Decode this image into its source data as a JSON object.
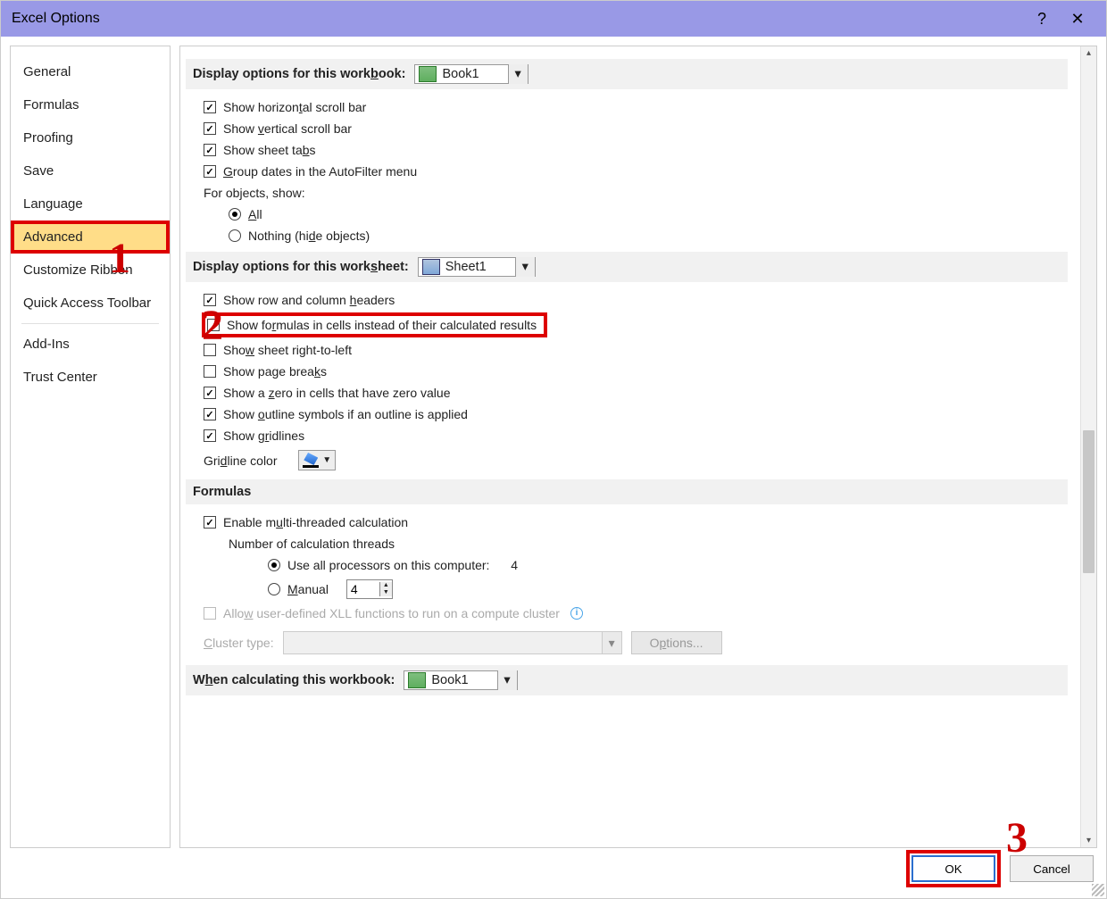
{
  "title": "Excel Options",
  "titlebar": {
    "help": "?",
    "close": "✕"
  },
  "annotations": {
    "a1": "1",
    "a2": "2",
    "a3": "3"
  },
  "sidebar": {
    "items": [
      {
        "label": "General"
      },
      {
        "label": "Formulas"
      },
      {
        "label": "Proofing"
      },
      {
        "label": "Save"
      },
      {
        "label": "Language"
      },
      {
        "label": "Advanced",
        "selected": true
      },
      {
        "label": "Customize Ribbon"
      },
      {
        "label": "Quick Access Toolbar"
      },
      {
        "label": "Add-Ins"
      },
      {
        "label": "Trust Center"
      }
    ]
  },
  "sec_workbook": {
    "title_pre": "Display options for this work",
    "title_u": "b",
    "title_post": "ook:",
    "dd": "Book1"
  },
  "wb_opts": {
    "hscroll_pre": "Show horizon",
    "hscroll_u": "t",
    "hscroll_post": "al scroll bar",
    "vscroll_pre": "Show ",
    "vscroll_u": "v",
    "vscroll_post": "ertical scroll bar",
    "tabs_pre": "Show sheet ta",
    "tabs_u": "b",
    "tabs_post": "s",
    "group_pre": "",
    "group_u": "G",
    "group_post": "roup dates in the AutoFilter menu",
    "objlabel": "For objects, show:",
    "all_u": "A",
    "all_post": "ll",
    "nothing_pre": "Nothing (hi",
    "nothing_u": "d",
    "nothing_post": "e objects)"
  },
  "sec_worksheet": {
    "title_pre": "Display options for this work",
    "title_u": "s",
    "title_post": "heet:",
    "dd": "Sheet1"
  },
  "ws_opts": {
    "headers_pre": "Show row and column ",
    "headers_u": "h",
    "headers_post": "eaders",
    "formulas_pre": "Show fo",
    "formulas_u": "r",
    "formulas_post": "mulas in cells instead of their calculated results",
    "rtl_pre": "Sho",
    "rtl_u": "w",
    "rtl_post": " sheet right-to-left",
    "pgbrk_pre": "Show page brea",
    "pgbrk_u": "k",
    "pgbrk_post": "s",
    "zero_pre": "Show a ",
    "zero_u": "z",
    "zero_post": "ero in cells that have zero value",
    "outline_pre": "Show ",
    "outline_u": "o",
    "outline_post": "utline symbols if an outline is applied",
    "grid_pre": "Show g",
    "grid_u": "r",
    "grid_post": "idlines",
    "gridcolor_pre": "Gri",
    "gridcolor_u": "d",
    "gridcolor_post": "line color"
  },
  "sec_formulas": {
    "title": "Formulas"
  },
  "f_opts": {
    "multi_pre": "Enable m",
    "multi_u": "u",
    "multi_post": "lti-threaded calculation",
    "threads_label": "Number of calculation threads",
    "all_proc": "Use all processors on this computer:",
    "proc_count": "4",
    "manual_u": "M",
    "manual_post": "anual",
    "manual_val": "4",
    "xll_pre": "Allo",
    "xll_u": "w",
    "xll_post": " user-defined XLL functions to run on a compute cluster",
    "cluster_pre": "",
    "cluster_u": "C",
    "cluster_post": "luster type:",
    "options_btn_pre": "O",
    "options_btn_u": "p",
    "options_btn_post": "tions..."
  },
  "sec_calc": {
    "title_pre": "W",
    "title_u": "h",
    "title_post": "en calculating this workbook:",
    "dd": "Book1"
  },
  "footer": {
    "ok": "OK",
    "cancel": "Cancel"
  }
}
